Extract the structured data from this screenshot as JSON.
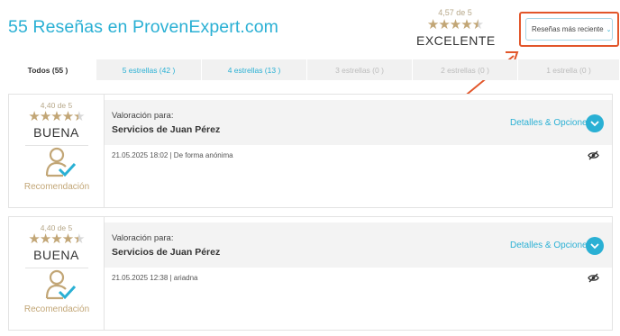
{
  "header": {
    "title": "55 Reseñas en ProvenExpert.com",
    "summary_score": "4,57 de 5",
    "summary_rating": 4.57,
    "summary_verdict": "EXCELENTE",
    "sort_label": "Reseñas más reciente",
    "sort_icon": "chevron-down-icon"
  },
  "tabs": [
    {
      "label": "Todos (55 )",
      "state": "active"
    },
    {
      "label": "5 estrellas (42 )",
      "state": "link"
    },
    {
      "label": "4 estrellas (13 )",
      "state": "link"
    },
    {
      "label": "3 estrellas (0 )",
      "state": "disabled"
    },
    {
      "label": "2 estrellas (0 )",
      "state": "disabled"
    },
    {
      "label": "1 estrella (0 )",
      "state": "disabled"
    }
  ],
  "reviews": [
    {
      "score": "4,40 de 5",
      "rating": 4.4,
      "verdict": "BUENA",
      "recommendation": "Recomendación",
      "valuation_for": "Valoración para:",
      "company": "Servicios de Juan Pérez",
      "details_label": "Detalles & Opciones",
      "meta": "21.05.2025 18:02 | De forma anónima"
    },
    {
      "score": "4,40 de 5",
      "rating": 4.4,
      "verdict": "BUENA",
      "recommendation": "Recomendación",
      "valuation_for": "Valoración para:",
      "company": "Servicios de Juan Pérez",
      "details_label": "Detalles & Opciones",
      "meta": "21.05.2025 12:38 | ariadna"
    }
  ],
  "colors": {
    "accent": "#2ab0d4",
    "gold": "#c2a676",
    "highlight": "#e2562a"
  }
}
